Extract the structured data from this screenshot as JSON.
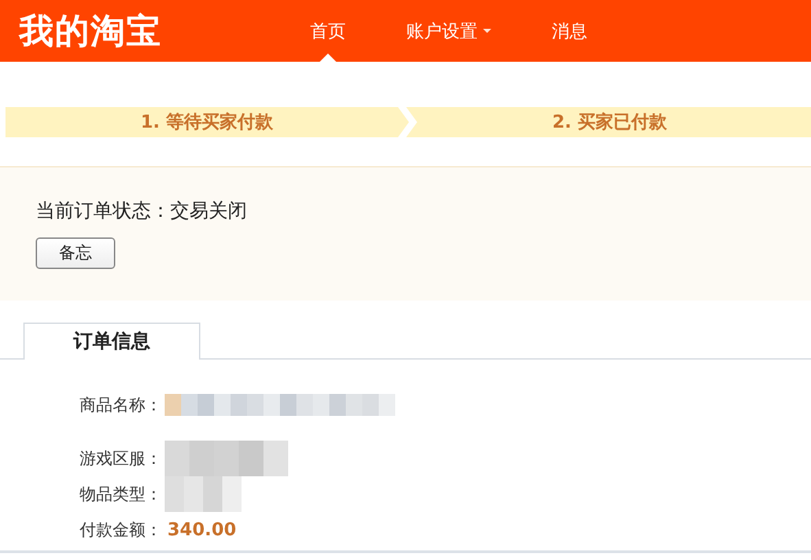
{
  "header": {
    "logo": "我的淘宝",
    "nav": [
      {
        "label": "首页",
        "selected": true,
        "dropdown": false
      },
      {
        "label": "账户设置",
        "selected": false,
        "dropdown": true
      },
      {
        "label": "消息",
        "selected": false,
        "dropdown": false
      }
    ]
  },
  "steps": [
    {
      "label": "1. 等待买家付款"
    },
    {
      "label": "2. 买家已付款"
    }
  ],
  "order_status": {
    "text": "当前订单状态：交易关闭",
    "button": "备忘"
  },
  "tabs": [
    {
      "label": "订单信息",
      "selected": true
    }
  ],
  "fields": [
    {
      "label": "商品名称：",
      "kind": "redacted-long"
    },
    {
      "label": "游戏区服：",
      "kind": "redacted-short"
    },
    {
      "label": "物品类型：",
      "kind": "redacted-small"
    },
    {
      "label": "付款金额：",
      "kind": "amount",
      "value": "340.00"
    }
  ]
}
